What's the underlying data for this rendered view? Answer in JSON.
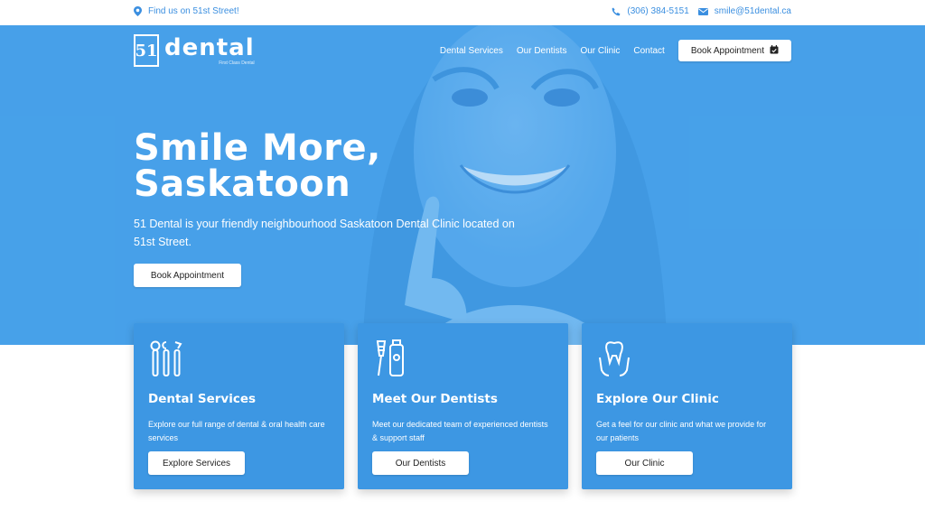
{
  "topbar": {
    "location": "Find us on 51st Street!",
    "phone": "(306) 384-5151",
    "email": "smile@51dental.ca"
  },
  "brand": {
    "mark": "51",
    "wordmark": "dental",
    "tagline": "First Class Dental"
  },
  "nav": {
    "items": [
      "Dental Services",
      "Our Dentists",
      "Our Clinic",
      "Contact"
    ],
    "cta": "Book Appointment"
  },
  "hero": {
    "headline_line1": "Smile More,",
    "headline_line2": "Saskatoon",
    "subtitle": "51 Dental is your friendly neighbourhood Saskatoon Dental Clinic located on 51st Street.",
    "cta": "Book Appointment"
  },
  "cards": [
    {
      "icon": "dental-tools-icon",
      "title": "Dental Services",
      "text": "Explore our full range of dental & oral health care services",
      "button": "Explore Services"
    },
    {
      "icon": "toothbrush-toothpaste-icon",
      "title": "Meet Our Dentists",
      "text": "Meet our dedicated team of experienced dentists & support staff",
      "button": "Our Dentists"
    },
    {
      "icon": "tooth-hands-icon",
      "title": "Explore Our Clinic",
      "text": "Get a feel for our clinic and what we provide for our patients",
      "button": "Our Clinic"
    }
  ],
  "colors": {
    "primary": "#3d97e3",
    "hero": "#4aa2ea",
    "topbar_text": "#3b8fe0"
  }
}
